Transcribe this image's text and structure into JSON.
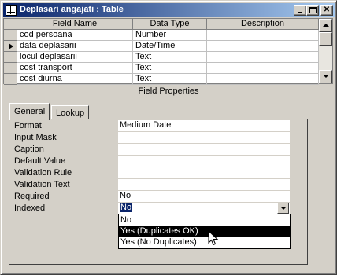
{
  "window": {
    "title": "Deplasari angajati : Table"
  },
  "grid": {
    "columns": [
      "Field Name",
      "Data Type",
      "Description"
    ],
    "rows": [
      {
        "field": "cod persoana",
        "type": "Number",
        "description": "",
        "current": false
      },
      {
        "field": "data deplasarii",
        "type": "Date/Time",
        "description": "",
        "current": true
      },
      {
        "field": "locul deplasarii",
        "type": "Text",
        "description": "",
        "current": false
      },
      {
        "field": "cost transport",
        "type": "Text",
        "description": "",
        "current": false
      },
      {
        "field": "cost diurna",
        "type": "Text",
        "description": "",
        "current": false
      }
    ]
  },
  "field_properties": {
    "title": "Field Properties",
    "tabs": [
      {
        "label": "General",
        "active": true
      },
      {
        "label": "Lookup",
        "active": false
      }
    ],
    "properties": [
      {
        "label": "Format",
        "value": "Medium Date"
      },
      {
        "label": "Input Mask",
        "value": ""
      },
      {
        "label": "Caption",
        "value": ""
      },
      {
        "label": "Default Value",
        "value": ""
      },
      {
        "label": "Validation Rule",
        "value": ""
      },
      {
        "label": "Validation Text",
        "value": ""
      },
      {
        "label": "Required",
        "value": "No"
      },
      {
        "label": "Indexed",
        "value": "No"
      }
    ]
  },
  "indexed_dropdown": {
    "options": [
      "No",
      "Yes (Duplicates OK)",
      "Yes (No Duplicates)"
    ],
    "highlighted_index": 1
  }
}
